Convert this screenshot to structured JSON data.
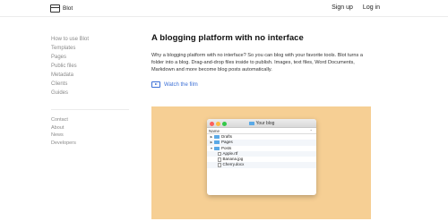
{
  "header": {
    "logo_text": "Blot",
    "signup_label": "Sign up",
    "login_label": "Log in"
  },
  "sidebar": {
    "primary": [
      {
        "label": "How to use Blot"
      },
      {
        "label": "Templates"
      },
      {
        "label": "Pages"
      },
      {
        "label": "Public files"
      },
      {
        "label": "Metadata"
      },
      {
        "label": "Clients"
      },
      {
        "label": "Guides"
      }
    ],
    "secondary": [
      {
        "label": "Contact"
      },
      {
        "label": "About"
      },
      {
        "label": "News"
      },
      {
        "label": "Developers"
      }
    ]
  },
  "main": {
    "headline": "A blogging platform with no interface",
    "description": "Why a blogging platform with no interface? So you can blog with your favorite tools. Blot turns a folder into a blog. Drag-and-drop files inside to publish. Images, text files, Word Documents, Markdown and more become blog posts automatically.",
    "watch_label": "Watch the film"
  },
  "finder": {
    "window_title": "Your blog",
    "column_header": "Name",
    "rows": [
      {
        "label": "Drafts",
        "kind": "folder",
        "expanded": false
      },
      {
        "label": "Pages",
        "kind": "folder",
        "expanded": false
      },
      {
        "label": "Posts",
        "kind": "folder",
        "expanded": true
      },
      {
        "label": "Apple.rtf",
        "kind": "file"
      },
      {
        "label": "Banana.jpg",
        "kind": "file"
      },
      {
        "label": "Cherry.docx",
        "kind": "file"
      }
    ]
  },
  "colors": {
    "accent_link": "#3b6fd6",
    "demo_background": "#f6cf94",
    "folder_blue": "#5aa9e6"
  }
}
